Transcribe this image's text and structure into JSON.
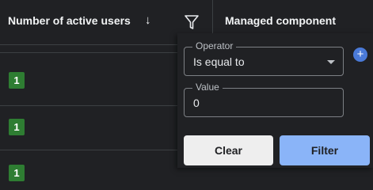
{
  "header": {
    "column_title": "Number of active users",
    "sort_glyph": "↓",
    "filter_icon": "filter-icon",
    "column2_title": "Managed component"
  },
  "rows": [
    {
      "value": "1"
    },
    {
      "value": "1"
    },
    {
      "value": "1"
    }
  ],
  "filter_popup": {
    "operator_label": "Operator",
    "operator_value": "Is equal to",
    "value_label": "Value",
    "value": "0",
    "add_glyph": "+",
    "clear_label": "Clear",
    "filter_label": "Filter"
  },
  "colors": {
    "background": "#202124",
    "badge": "#2e7d32",
    "accent": "#8ab4f8",
    "add_button": "#4a7ad8"
  }
}
